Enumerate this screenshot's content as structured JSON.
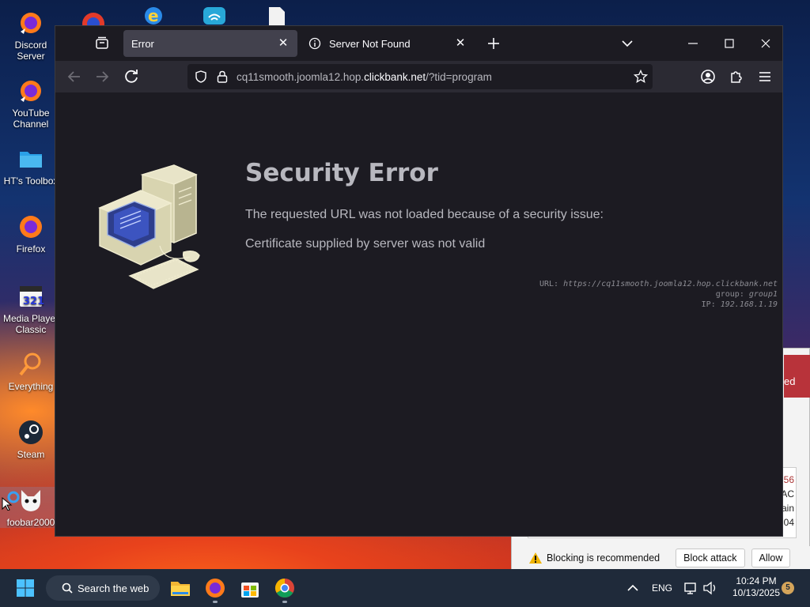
{
  "desktop": {
    "icons": [
      {
        "label": "Discord Server"
      },
      {
        "label": "YouTube Channel"
      },
      {
        "label": "HT's Toolbox"
      },
      {
        "label": "Firefox"
      },
      {
        "label": "Media Player Classic"
      },
      {
        "label": "Everything"
      },
      {
        "label": "Steam"
      },
      {
        "label": "foobar2000"
      }
    ]
  },
  "browser": {
    "tabs": [
      {
        "label": "Error"
      },
      {
        "label": "Server Not Found"
      }
    ],
    "url": {
      "prefix": "cq11smooth.joomla12.hop.",
      "host": "clickbank.net",
      "suffix": "/?tid=program"
    }
  },
  "error_page": {
    "title": "Security Error",
    "message": "The requested URL was not loaded because of a security issue:",
    "reason": "Certificate supplied by server was not valid",
    "details": {
      "url_label": "URL:",
      "url_value": "https://cq11smooth.joomla12.hop.clickbank.net",
      "group_label": "group:",
      "group_value": "group1",
      "ip_label": "IP:",
      "ip_value": "192.168.1.19"
    }
  },
  "background_window": {
    "header_text": "ed",
    "box_lines": [
      "56",
      "AC",
      "ain",
      "04"
    ],
    "warning_text": "Blocking is recommended",
    "block_button": "Block attack",
    "allow_button": "Allow"
  },
  "taskbar": {
    "search_label": "Search the web",
    "language": "ENG",
    "time": "10:24 PM",
    "date": "10/13/2025",
    "notification_badge": "5"
  }
}
